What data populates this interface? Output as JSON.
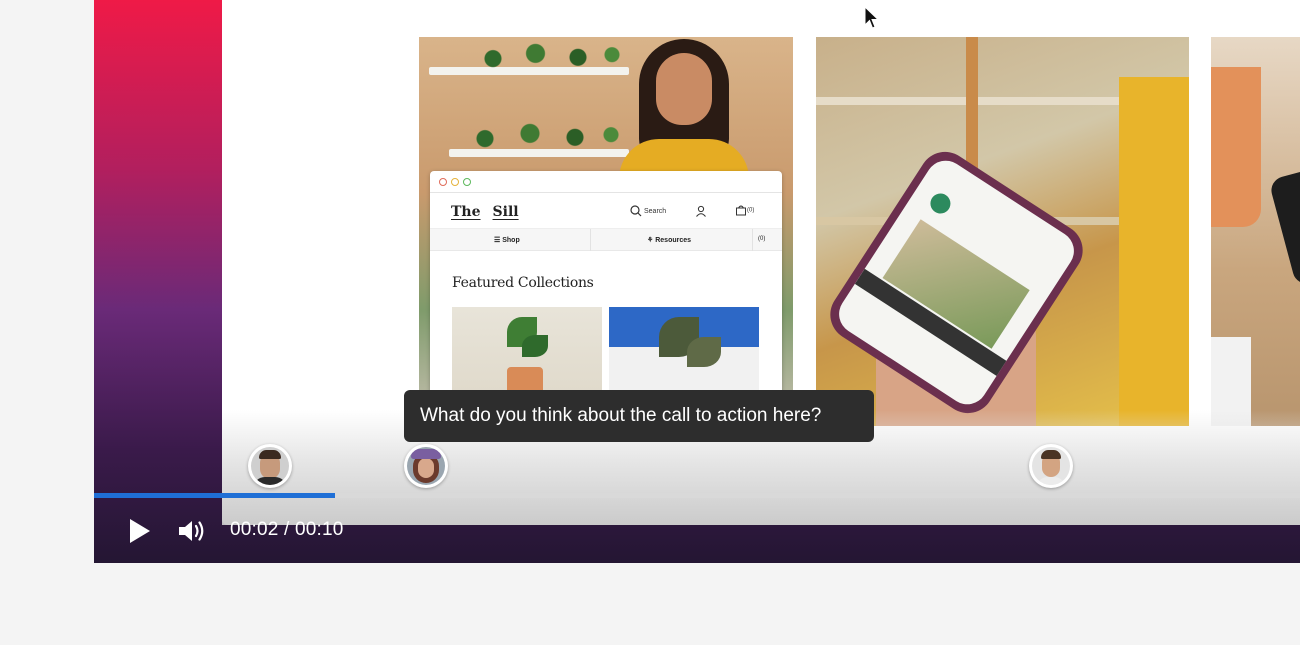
{
  "player": {
    "current_time": "00:02",
    "separator": " / ",
    "duration": "00:10",
    "progress_fraction": 0.2,
    "accent_color": "#1f6fd6"
  },
  "comment": {
    "text": "What do you think about the call to action here?"
  },
  "markers": [
    {
      "name": "commenter-1",
      "icon": "avatar"
    },
    {
      "name": "commenter-2",
      "icon": "avatar"
    },
    {
      "name": "commenter-3",
      "icon": "avatar"
    }
  ],
  "mock_site": {
    "brand_left": "The",
    "brand_right": "Sill",
    "search_label": "Search",
    "cart_count": "(0)",
    "nav_shop": "Shop",
    "nav_resources": "Resources",
    "nav_cart": "(0)",
    "featured_heading": "Featured Collections"
  },
  "icons": {
    "play": "play-icon",
    "volume": "volume-icon",
    "cursor": "mouse-cursor-icon"
  }
}
